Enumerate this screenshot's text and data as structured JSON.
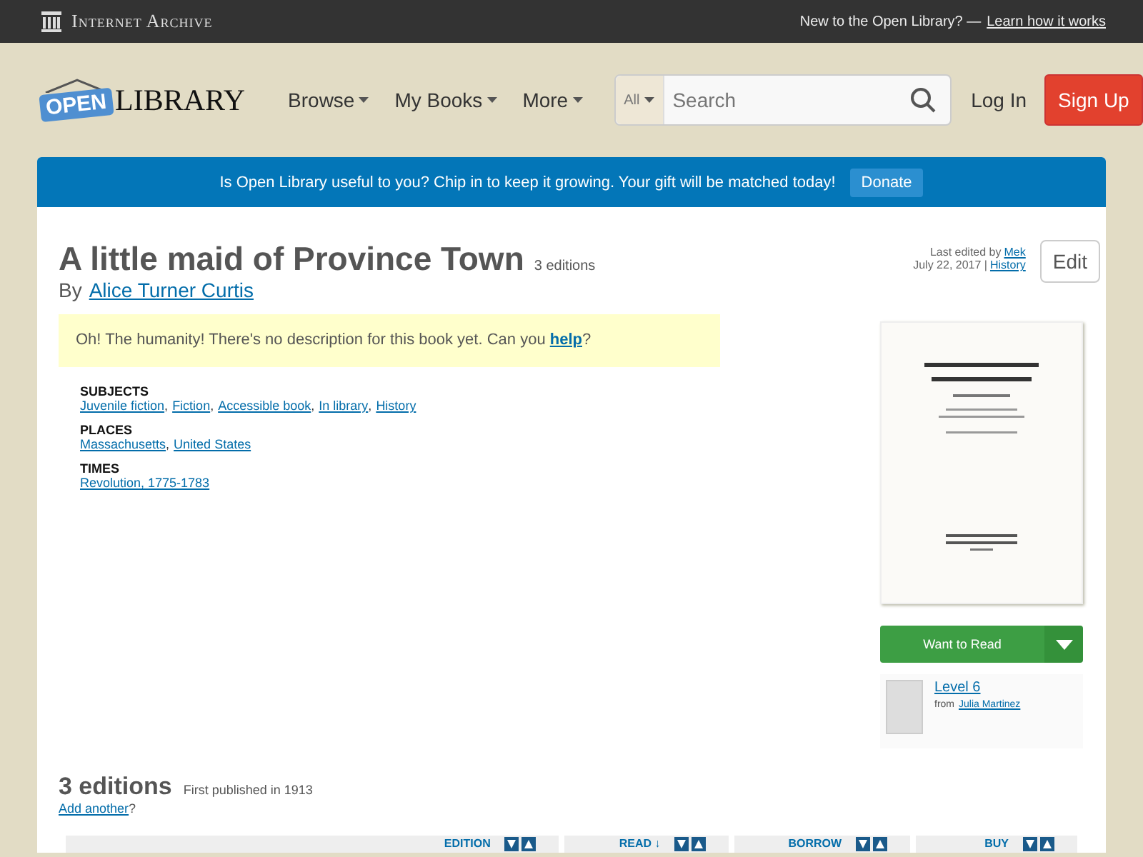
{
  "top_bar": {
    "brand": "Internet Archive",
    "prompt": "New to the Open Library? —",
    "link": "Learn how it works"
  },
  "header": {
    "logo_badge": "OPEN",
    "logo_text": "LIBRARY",
    "nav": [
      "Browse",
      "My Books",
      "More"
    ],
    "search": {
      "scope": "All",
      "placeholder": "Search"
    },
    "login": "Log In",
    "signup": "Sign Up"
  },
  "banner": {
    "text": "Is Open Library useful to you? Chip in to keep it growing. Your gift will be matched today!",
    "button": "Donate"
  },
  "book": {
    "title": "A little maid of Province Town",
    "edition_count": "3 editions",
    "by": "By",
    "author": "Alice Turner Curtis",
    "last_edited": "Last edited by",
    "editor": "Mek",
    "date": "July 22, 2017 |",
    "history": "History",
    "edit": "Edit",
    "description": "Oh! The humanity! There's no description for this book yet. Can you **help**?",
    "facets": [
      {
        "heading": "SUBJECTS",
        "separator": ",",
        "links": [
          "Juvenile fiction",
          "Fiction",
          "Accessible book",
          "In library",
          "History"
        ]
      },
      {
        "heading": "PLACES",
        "separator": ",",
        "links": [
          "Massachusetts",
          "United States"
        ]
      },
      {
        "heading": "TIMES",
        "links": [
          "Revolution, 1775-1783"
        ]
      }
    ]
  },
  "sidebar": {
    "want": "Want to Read",
    "list": {
      "name": "Level 6",
      "from": "from",
      "owner": "Julia Martinez"
    }
  },
  "editions": {
    "heading": "3 editions",
    "published": "First published in 1913",
    "add": "Add another",
    "add_suffix": "?",
    "columns": [
      "EDITION",
      "READ ↓",
      "BORROW",
      "BUY"
    ]
  }
}
